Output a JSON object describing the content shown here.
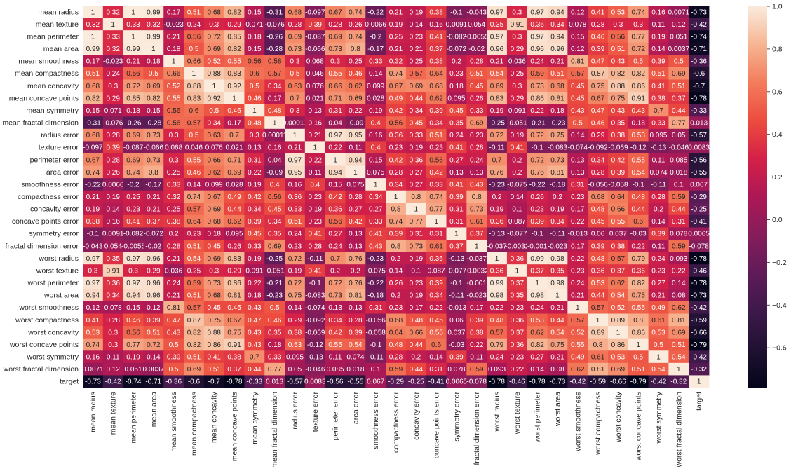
{
  "chart_data": {
    "type": "heatmap",
    "title": "",
    "xlabel": "",
    "ylabel": "",
    "colormap": "rocket",
    "vmin": -0.79,
    "vmax": 1.0,
    "colorbar": {
      "position": "right",
      "ticks": [
        "1.0",
        "0.8",
        "0.6",
        "0.4",
        "0.2",
        "0.0",
        "−0.2",
        "−0.4",
        "−0.6"
      ],
      "tick_values": [
        1.0,
        0.8,
        0.6,
        0.4,
        0.2,
        0.0,
        -0.2,
        -0.4,
        -0.6
      ]
    },
    "labels": [
      "mean radius",
      "mean texture",
      "mean perimeter",
      "mean area",
      "mean smoothness",
      "mean compactness",
      "mean concavity",
      "mean concave points",
      "mean symmetry",
      "mean fractal dimension",
      "radius error",
      "texture error",
      "perimeter error",
      "area error",
      "smoothness error",
      "compactness error",
      "concavity error",
      "concave points error",
      "symmetry error",
      "fractal dimension error",
      "worst radius",
      "worst texture",
      "worst perimeter",
      "worst area",
      "worst smoothness",
      "worst compactness",
      "worst concavity",
      "worst concave points",
      "worst symmetry",
      "worst fractal dimension",
      "target"
    ],
    "matrix": [
      [
        "1",
        "0.32",
        "1",
        "0.99",
        "0.17",
        "0.51",
        "0.68",
        "0.82",
        "0.15",
        "-0.31",
        "0.68",
        "-0.097",
        "0.67",
        "0.74",
        "-0.22",
        "0.21",
        "0.19",
        "0.38",
        "-0.1",
        "-0.043",
        "0.97",
        "0.3",
        "0.97",
        "0.94",
        "0.12",
        "0.41",
        "0.53",
        "0.74",
        "0.16",
        "0.0071",
        "-0.73"
      ],
      [
        "0.32",
        "1",
        "0.33",
        "0.32",
        "-0.023",
        "0.24",
        "0.3",
        "0.29",
        "0.071",
        "-0.076",
        "0.28",
        "0.39",
        "0.28",
        "0.26",
        "0.0066",
        "0.19",
        "0.14",
        "0.16",
        "0.0091",
        "0.054",
        "0.35",
        "0.91",
        "0.36",
        "0.34",
        "0.078",
        "0.28",
        "0.3",
        "0.3",
        "0.11",
        "0.12",
        "-0.42"
      ],
      [
        "1",
        "0.33",
        "1",
        "0.99",
        "0.21",
        "0.56",
        "0.72",
        "0.85",
        "0.18",
        "-0.26",
        "0.69",
        "-0.087",
        "0.69",
        "0.74",
        "-0.2",
        "0.25",
        "0.23",
        "0.41",
        "-0.082",
        "-0.0055",
        "0.97",
        "0.3",
        "0.97",
        "0.94",
        "0.15",
        "0.46",
        "0.56",
        "0.77",
        "0.19",
        "0.051",
        "-0.74"
      ],
      [
        "0.99",
        "0.32",
        "0.99",
        "1",
        "0.18",
        "0.5",
        "0.69",
        "0.82",
        "0.15",
        "-0.28",
        "0.73",
        "-0.066",
        "0.73",
        "0.8",
        "-0.17",
        "0.21",
        "0.21",
        "0.37",
        "-0.072",
        "-0.02",
        "0.96",
        "0.29",
        "0.96",
        "0.96",
        "0.12",
        "0.39",
        "0.51",
        "0.72",
        "0.14",
        "0.0037",
        "-0.71"
      ],
      [
        "0.17",
        "-0.023",
        "0.21",
        "0.18",
        "1",
        "0.66",
        "0.52",
        "0.55",
        "0.56",
        "0.58",
        "0.3",
        "0.068",
        "0.3",
        "0.25",
        "0.33",
        "0.32",
        "0.25",
        "0.38",
        "0.2",
        "0.28",
        "0.21",
        "0.036",
        "0.24",
        "0.21",
        "0.81",
        "0.47",
        "0.43",
        "0.5",
        "0.39",
        "0.5",
        "-0.36"
      ],
      [
        "0.51",
        "0.24",
        "0.56",
        "0.5",
        "0.66",
        "1",
        "0.88",
        "0.83",
        "0.6",
        "0.57",
        "0.5",
        "0.046",
        "0.55",
        "0.46",
        "0.14",
        "0.74",
        "0.57",
        "0.64",
        "0.23",
        "0.51",
        "0.54",
        "0.25",
        "0.59",
        "0.51",
        "0.57",
        "0.87",
        "0.82",
        "0.82",
        "0.51",
        "0.69",
        "-0.6"
      ],
      [
        "0.68",
        "0.3",
        "0.72",
        "0.69",
        "0.52",
        "0.88",
        "1",
        "0.92",
        "0.5",
        "0.34",
        "0.63",
        "0.076",
        "0.66",
        "0.62",
        "0.099",
        "0.67",
        "0.69",
        "0.68",
        "0.18",
        "0.45",
        "0.69",
        "0.3",
        "0.73",
        "0.68",
        "0.45",
        "0.75",
        "0.88",
        "0.86",
        "0.41",
        "0.51",
        "-0.7"
      ],
      [
        "0.82",
        "0.29",
        "0.85",
        "0.82",
        "0.55",
        "0.83",
        "0.92",
        "1",
        "0.46",
        "0.17",
        "0.7",
        "0.021",
        "0.71",
        "0.69",
        "0.028",
        "0.49",
        "0.44",
        "0.62",
        "0.095",
        "0.26",
        "0.83",
        "0.29",
        "0.86",
        "0.81",
        "0.45",
        "0.67",
        "0.75",
        "0.91",
        "0.38",
        "0.37",
        "-0.78"
      ],
      [
        "0.15",
        "0.071",
        "0.18",
        "0.15",
        "0.56",
        "0.6",
        "0.5",
        "0.46",
        "1",
        "0.48",
        "0.3",
        "0.13",
        "0.31",
        "0.22",
        "0.19",
        "0.42",
        "0.34",
        "0.39",
        "0.45",
        "0.33",
        "0.19",
        "0.091",
        "0.22",
        "0.18",
        "0.43",
        "0.47",
        "0.43",
        "0.43",
        "0.7",
        "0.44",
        "-0.33"
      ],
      [
        "-0.31",
        "-0.076",
        "-0.26",
        "-0.28",
        "0.58",
        "0.57",
        "0.34",
        "0.17",
        "0.48",
        "1",
        "0.00011",
        "0.16",
        "0.04",
        "-0.09",
        "0.4",
        "0.56",
        "0.45",
        "0.34",
        "0.35",
        "0.69",
        "-0.25",
        "-0.051",
        "-0.21",
        "-0.23",
        "0.5",
        "0.46",
        "0.35",
        "0.18",
        "0.33",
        "0.77",
        "0.013"
      ],
      [
        "0.68",
        "0.28",
        "0.69",
        "0.73",
        "0.3",
        "0.5",
        "0.63",
        "0.7",
        "0.3",
        "0.00011",
        "1",
        "0.21",
        "0.97",
        "0.95",
        "0.16",
        "0.36",
        "0.33",
        "0.51",
        "0.24",
        "0.23",
        "0.72",
        "0.19",
        "0.72",
        "0.75",
        "0.14",
        "0.29",
        "0.38",
        "0.53",
        "0.095",
        "0.05",
        "-0.57"
      ],
      [
        "-0.097",
        "0.39",
        "-0.087",
        "-0.066",
        "0.068",
        "0.046",
        "0.076",
        "0.021",
        "0.13",
        "0.16",
        "0.21",
        "1",
        "0.22",
        "0.11",
        "0.4",
        "0.23",
        "0.19",
        "0.23",
        "0.41",
        "0.28",
        "-0.11",
        "0.41",
        "-0.1",
        "-0.083",
        "-0.074",
        "-0.092",
        "-0.069",
        "-0.12",
        "-0.13",
        "-0.046",
        "0.0083"
      ],
      [
        "0.67",
        "0.28",
        "0.69",
        "0.73",
        "0.3",
        "0.55",
        "0.66",
        "0.71",
        "0.31",
        "0.04",
        "0.97",
        "0.22",
        "1",
        "0.94",
        "0.15",
        "0.42",
        "0.36",
        "0.56",
        "0.27",
        "0.24",
        "0.7",
        "0.2",
        "0.72",
        "0.73",
        "0.13",
        "0.34",
        "0.42",
        "0.55",
        "0.11",
        "0.085",
        "-0.56"
      ],
      [
        "0.74",
        "0.26",
        "0.74",
        "0.8",
        "0.25",
        "0.46",
        "0.62",
        "0.69",
        "0.22",
        "-0.09",
        "0.95",
        "0.11",
        "0.94",
        "1",
        "0.075",
        "0.28",
        "0.27",
        "0.42",
        "0.13",
        "0.13",
        "0.76",
        "0.2",
        "0.76",
        "0.81",
        "0.13",
        "0.28",
        "0.39",
        "0.54",
        "0.074",
        "0.018",
        "-0.55"
      ],
      [
        "-0.22",
        "0.0066",
        "-0.2",
        "-0.17",
        "0.33",
        "0.14",
        "0.099",
        "0.028",
        "0.19",
        "0.4",
        "0.16",
        "0.4",
        "0.15",
        "0.075",
        "1",
        "0.34",
        "0.27",
        "0.33",
        "0.41",
        "0.43",
        "-0.23",
        "-0.075",
        "-0.22",
        "-0.18",
        "0.31",
        "-0.056",
        "-0.058",
        "-0.1",
        "-0.11",
        "0.1",
        "0.067"
      ],
      [
        "0.21",
        "0.19",
        "0.25",
        "0.21",
        "0.32",
        "0.74",
        "0.67",
        "0.49",
        "0.42",
        "0.56",
        "0.36",
        "0.23",
        "0.42",
        "0.28",
        "0.34",
        "1",
        "0.8",
        "0.74",
        "0.39",
        "0.8",
        "0.2",
        "0.14",
        "0.26",
        "0.2",
        "0.23",
        "0.68",
        "0.64",
        "0.48",
        "0.28",
        "0.59",
        "-0.29"
      ],
      [
        "0.19",
        "0.14",
        "0.23",
        "0.21",
        "0.25",
        "0.57",
        "0.69",
        "0.44",
        "0.34",
        "0.45",
        "0.33",
        "0.19",
        "0.36",
        "0.27",
        "0.27",
        "0.8",
        "1",
        "0.77",
        "0.31",
        "0.73",
        "0.19",
        "0.1",
        "0.23",
        "0.19",
        "0.17",
        "0.48",
        "0.66",
        "0.44",
        "0.2",
        "0.44",
        "-0.25"
      ],
      [
        "0.38",
        "0.16",
        "0.41",
        "0.37",
        "0.38",
        "0.64",
        "0.68",
        "0.62",
        "0.39",
        "0.34",
        "0.51",
        "0.23",
        "0.56",
        "0.42",
        "0.33",
        "0.74",
        "0.77",
        "1",
        "0.31",
        "0.61",
        "0.36",
        "0.087",
        "0.39",
        "0.34",
        "0.22",
        "0.45",
        "0.55",
        "0.6",
        "0.14",
        "0.31",
        "-0.41"
      ],
      [
        "-0.1",
        "0.0091",
        "-0.082",
        "-0.072",
        "0.2",
        "0.23",
        "0.18",
        "0.095",
        "0.45",
        "0.35",
        "0.24",
        "0.41",
        "0.27",
        "0.13",
        "0.41",
        "0.39",
        "0.31",
        "0.31",
        "1",
        "0.37",
        "-0.13",
        "-0.077",
        "-0.1",
        "-0.11",
        "-0.013",
        "0.06",
        "0.037",
        "-0.03",
        "0.39",
        "0.078",
        "0.0065"
      ],
      [
        "-0.043",
        "0.054",
        "-0.0055",
        "-0.02",
        "0.28",
        "0.51",
        "0.45",
        "0.26",
        "0.33",
        "0.69",
        "0.23",
        "0.28",
        "0.24",
        "0.13",
        "0.43",
        "0.8",
        "0.73",
        "0.61",
        "0.37",
        "1",
        "-0.037",
        "-0.0032",
        "-0.001",
        "-0.023",
        "0.17",
        "0.39",
        "0.38",
        "0.22",
        "0.11",
        "0.59",
        "-0.078"
      ],
      [
        "0.97",
        "0.35",
        "0.97",
        "0.96",
        "0.21",
        "0.54",
        "0.69",
        "0.83",
        "0.19",
        "-0.25",
        "0.72",
        "-0.11",
        "0.7",
        "0.76",
        "-0.23",
        "0.2",
        "0.19",
        "0.36",
        "-0.13",
        "-0.037",
        "1",
        "0.36",
        "0.99",
        "0.98",
        "0.22",
        "0.48",
        "0.57",
        "0.79",
        "0.24",
        "0.093",
        "-0.78"
      ],
      [
        "0.3",
        "0.91",
        "0.3",
        "0.29",
        "0.036",
        "0.25",
        "0.3",
        "0.29",
        "0.091",
        "-0.051",
        "0.19",
        "0.41",
        "0.2",
        "0.2",
        "-0.075",
        "0.14",
        "0.1",
        "0.087",
        "-0.077",
        "-0.0032",
        "0.36",
        "1",
        "0.37",
        "0.35",
        "0.23",
        "0.36",
        "0.37",
        "0.36",
        "0.23",
        "0.22",
        "-0.46"
      ],
      [
        "0.97",
        "0.36",
        "0.97",
        "0.96",
        "0.24",
        "0.59",
        "0.73",
        "0.86",
        "0.22",
        "-0.21",
        "0.72",
        "-0.1",
        "0.72",
        "0.76",
        "-0.22",
        "0.26",
        "0.23",
        "0.39",
        "-0.1",
        "-0.001",
        "0.99",
        "0.37",
        "1",
        "0.98",
        "0.24",
        "0.53",
        "0.62",
        "0.82",
        "0.27",
        "0.14",
        "-0.78"
      ],
      [
        "0.94",
        "0.34",
        "0.94",
        "0.96",
        "0.21",
        "0.51",
        "0.68",
        "0.81",
        "0.18",
        "-0.23",
        "0.75",
        "-0.083",
        "0.73",
        "0.81",
        "-0.18",
        "0.2",
        "0.19",
        "0.34",
        "-0.11",
        "-0.023",
        "0.98",
        "0.35",
        "0.98",
        "1",
        "0.21",
        "0.44",
        "0.54",
        "0.75",
        "0.21",
        "0.08",
        "-0.73"
      ],
      [
        "0.12",
        "0.078",
        "0.15",
        "0.12",
        "0.81",
        "0.57",
        "0.45",
        "0.45",
        "0.43",
        "0.5",
        "0.14",
        "-0.074",
        "0.13",
        "0.13",
        "0.31",
        "0.23",
        "0.17",
        "0.22",
        "-0.013",
        "0.17",
        "0.22",
        "0.23",
        "0.24",
        "0.21",
        "1",
        "0.57",
        "0.52",
        "0.55",
        "0.49",
        "0.62",
        "-0.42"
      ],
      [
        "0.41",
        "0.28",
        "0.46",
        "0.39",
        "0.47",
        "0.87",
        "0.75",
        "0.67",
        "0.47",
        "0.46",
        "0.29",
        "-0.092",
        "0.34",
        "0.28",
        "-0.056",
        "0.68",
        "0.48",
        "0.45",
        "0.06",
        "0.39",
        "0.48",
        "0.36",
        "0.53",
        "0.44",
        "0.57",
        "1",
        "0.89",
        "0.8",
        "0.61",
        "0.81",
        "-0.59"
      ],
      [
        "0.53",
        "0.3",
        "0.56",
        "0.51",
        "0.43",
        "0.82",
        "0.88",
        "0.75",
        "0.43",
        "0.35",
        "0.38",
        "-0.069",
        "0.42",
        "0.39",
        "-0.058",
        "0.64",
        "0.66",
        "0.55",
        "0.037",
        "0.38",
        "0.57",
        "0.37",
        "0.62",
        "0.54",
        "0.52",
        "0.89",
        "1",
        "0.86",
        "0.53",
        "0.69",
        "-0.66"
      ],
      [
        "0.74",
        "0.3",
        "0.77",
        "0.72",
        "0.5",
        "0.82",
        "0.86",
        "0.91",
        "0.43",
        "0.18",
        "0.53",
        "-0.12",
        "0.55",
        "0.54",
        "-0.1",
        "0.48",
        "0.44",
        "0.6",
        "-0.03",
        "0.22",
        "0.79",
        "0.36",
        "0.82",
        "0.75",
        "0.55",
        "0.8",
        "0.86",
        "1",
        "0.5",
        "0.51",
        "-0.79"
      ],
      [
        "0.16",
        "0.11",
        "0.19",
        "0.14",
        "0.39",
        "0.51",
        "0.41",
        "0.38",
        "0.7",
        "0.33",
        "0.095",
        "-0.13",
        "0.11",
        "0.074",
        "-0.11",
        "0.28",
        "0.2",
        "0.14",
        "0.39",
        "0.11",
        "0.24",
        "0.23",
        "0.27",
        "0.21",
        "0.49",
        "0.61",
        "0.53",
        "0.5",
        "1",
        "0.54",
        "-0.42"
      ],
      [
        "0.0071",
        "0.12",
        "0.051",
        "0.0037",
        "0.5",
        "0.69",
        "0.51",
        "0.37",
        "0.44",
        "0.77",
        "0.05",
        "-0.046",
        "0.085",
        "0.018",
        "0.1",
        "0.59",
        "0.44",
        "0.31",
        "0.078",
        "0.59",
        "0.093",
        "0.22",
        "0.14",
        "0.08",
        "0.62",
        "0.81",
        "0.69",
        "0.51",
        "0.54",
        "1",
        "-0.32"
      ],
      [
        "-0.73",
        "-0.42",
        "-0.74",
        "-0.71",
        "-0.36",
        "-0.6",
        "-0.7",
        "-0.78",
        "-0.33",
        "0.013",
        "-0.57",
        "0.0083",
        "-0.56",
        "-0.55",
        "0.067",
        "-0.29",
        "-0.25",
        "-0.41",
        "0.0065",
        "-0.078",
        "-0.78",
        "-0.46",
        "-0.78",
        "-0.73",
        "-0.42",
        "-0.59",
        "-0.66",
        "-0.79",
        "-0.42",
        "-0.32",
        "1"
      ]
    ]
  }
}
